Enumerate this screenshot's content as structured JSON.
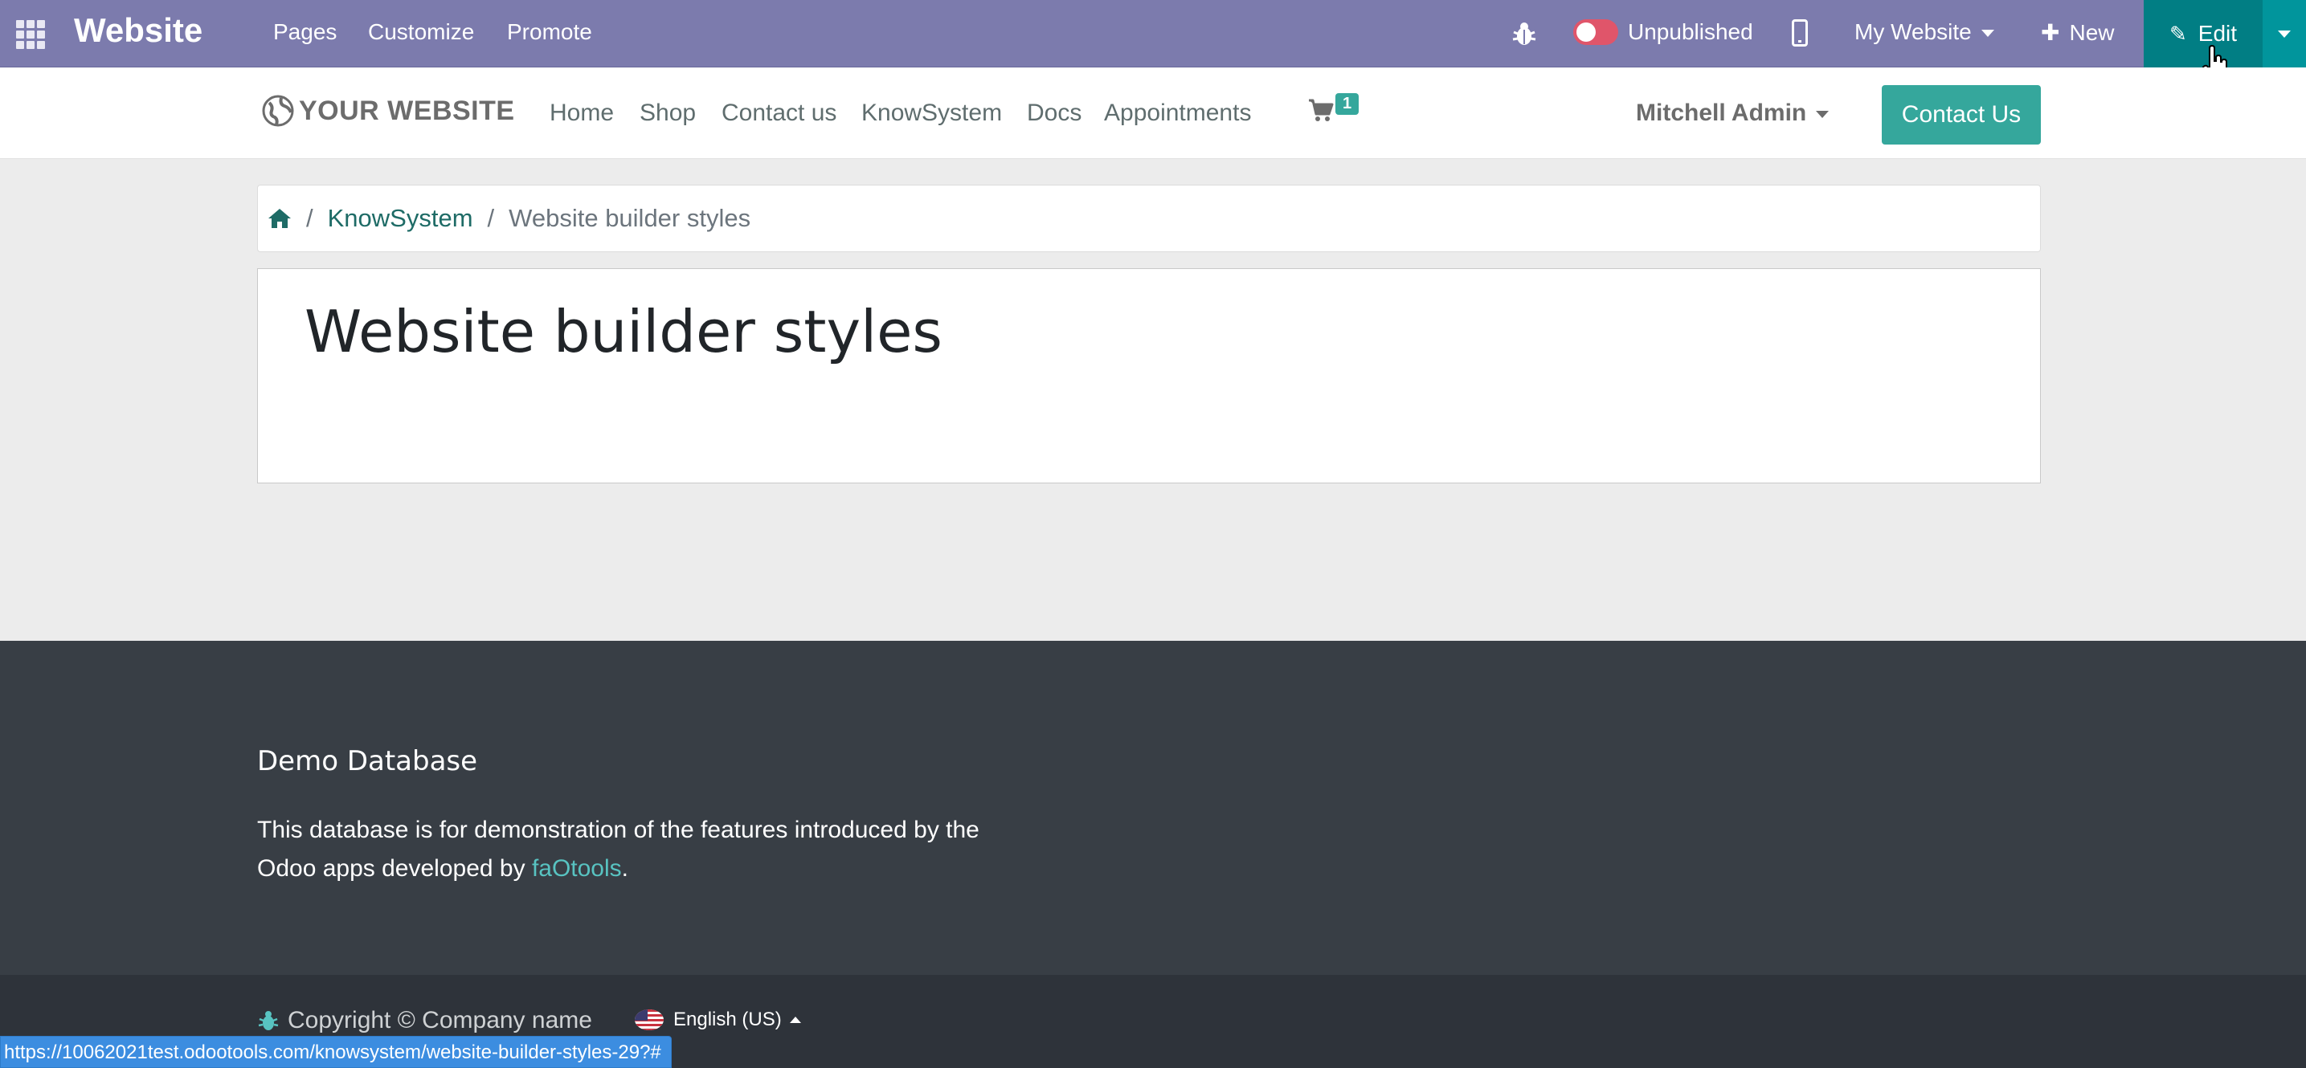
{
  "adminbar": {
    "brand": "Website",
    "menus": [
      "Pages",
      "Customize",
      "Promote"
    ],
    "status_label": "Unpublished",
    "website_selector": "My Website",
    "new_label": "New",
    "edit_label": "Edit",
    "colors": {
      "bar": "#7c7bad",
      "edit": "#017e84",
      "toggle_off": "#e0556a"
    }
  },
  "header": {
    "logo_text": "YOUR WEBSITE",
    "nav": [
      "Home",
      "Shop",
      "Contact us",
      "KnowSystem",
      "Docs",
      "Appointments"
    ],
    "cart_count": "1",
    "user_name": "Mitchell Admin",
    "contact_button": "Contact Us",
    "accent": "#35a79c"
  },
  "breadcrumb": {
    "items": [
      "KnowSystem",
      "Website builder styles"
    ]
  },
  "main": {
    "title": "Website builder styles"
  },
  "footer": {
    "heading": "Demo Database",
    "text_before": "This database is for demonstration of the features introduced by the Odoo apps developed by ",
    "link_text": "faOtools",
    "text_after": ".",
    "copyright": "Copyright © Company name",
    "language": "English (US)"
  },
  "status_bar": {
    "url": "https://10062021test.odootools.com/knowsystem/website-builder-styles-29?#"
  }
}
